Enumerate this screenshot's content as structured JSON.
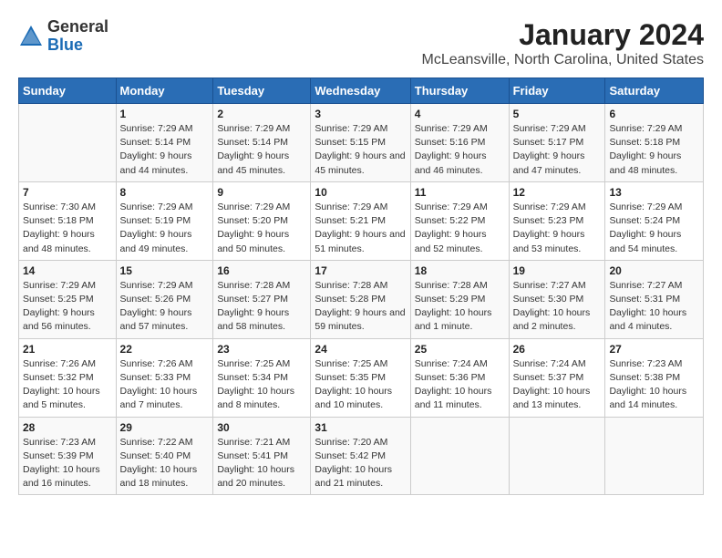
{
  "logo": {
    "general": "General",
    "blue": "Blue"
  },
  "title": "January 2024",
  "subtitle": "McLeansville, North Carolina, United States",
  "days_header": [
    "Sunday",
    "Monday",
    "Tuesday",
    "Wednesday",
    "Thursday",
    "Friday",
    "Saturday"
  ],
  "weeks": [
    [
      {
        "day": "",
        "sunrise": "",
        "sunset": "",
        "daylight": ""
      },
      {
        "day": "1",
        "sunrise": "Sunrise: 7:29 AM",
        "sunset": "Sunset: 5:14 PM",
        "daylight": "Daylight: 9 hours and 44 minutes."
      },
      {
        "day": "2",
        "sunrise": "Sunrise: 7:29 AM",
        "sunset": "Sunset: 5:14 PM",
        "daylight": "Daylight: 9 hours and 45 minutes."
      },
      {
        "day": "3",
        "sunrise": "Sunrise: 7:29 AM",
        "sunset": "Sunset: 5:15 PM",
        "daylight": "Daylight: 9 hours and 45 minutes."
      },
      {
        "day": "4",
        "sunrise": "Sunrise: 7:29 AM",
        "sunset": "Sunset: 5:16 PM",
        "daylight": "Daylight: 9 hours and 46 minutes."
      },
      {
        "day": "5",
        "sunrise": "Sunrise: 7:29 AM",
        "sunset": "Sunset: 5:17 PM",
        "daylight": "Daylight: 9 hours and 47 minutes."
      },
      {
        "day": "6",
        "sunrise": "Sunrise: 7:29 AM",
        "sunset": "Sunset: 5:18 PM",
        "daylight": "Daylight: 9 hours and 48 minutes."
      }
    ],
    [
      {
        "day": "7",
        "sunrise": "Sunrise: 7:30 AM",
        "sunset": "Sunset: 5:18 PM",
        "daylight": "Daylight: 9 hours and 48 minutes."
      },
      {
        "day": "8",
        "sunrise": "Sunrise: 7:29 AM",
        "sunset": "Sunset: 5:19 PM",
        "daylight": "Daylight: 9 hours and 49 minutes."
      },
      {
        "day": "9",
        "sunrise": "Sunrise: 7:29 AM",
        "sunset": "Sunset: 5:20 PM",
        "daylight": "Daylight: 9 hours and 50 minutes."
      },
      {
        "day": "10",
        "sunrise": "Sunrise: 7:29 AM",
        "sunset": "Sunset: 5:21 PM",
        "daylight": "Daylight: 9 hours and 51 minutes."
      },
      {
        "day": "11",
        "sunrise": "Sunrise: 7:29 AM",
        "sunset": "Sunset: 5:22 PM",
        "daylight": "Daylight: 9 hours and 52 minutes."
      },
      {
        "day": "12",
        "sunrise": "Sunrise: 7:29 AM",
        "sunset": "Sunset: 5:23 PM",
        "daylight": "Daylight: 9 hours and 53 minutes."
      },
      {
        "day": "13",
        "sunrise": "Sunrise: 7:29 AM",
        "sunset": "Sunset: 5:24 PM",
        "daylight": "Daylight: 9 hours and 54 minutes."
      }
    ],
    [
      {
        "day": "14",
        "sunrise": "Sunrise: 7:29 AM",
        "sunset": "Sunset: 5:25 PM",
        "daylight": "Daylight: 9 hours and 56 minutes."
      },
      {
        "day": "15",
        "sunrise": "Sunrise: 7:29 AM",
        "sunset": "Sunset: 5:26 PM",
        "daylight": "Daylight: 9 hours and 57 minutes."
      },
      {
        "day": "16",
        "sunrise": "Sunrise: 7:28 AM",
        "sunset": "Sunset: 5:27 PM",
        "daylight": "Daylight: 9 hours and 58 minutes."
      },
      {
        "day": "17",
        "sunrise": "Sunrise: 7:28 AM",
        "sunset": "Sunset: 5:28 PM",
        "daylight": "Daylight: 9 hours and 59 minutes."
      },
      {
        "day": "18",
        "sunrise": "Sunrise: 7:28 AM",
        "sunset": "Sunset: 5:29 PM",
        "daylight": "Daylight: 10 hours and 1 minute."
      },
      {
        "day": "19",
        "sunrise": "Sunrise: 7:27 AM",
        "sunset": "Sunset: 5:30 PM",
        "daylight": "Daylight: 10 hours and 2 minutes."
      },
      {
        "day": "20",
        "sunrise": "Sunrise: 7:27 AM",
        "sunset": "Sunset: 5:31 PM",
        "daylight": "Daylight: 10 hours and 4 minutes."
      }
    ],
    [
      {
        "day": "21",
        "sunrise": "Sunrise: 7:26 AM",
        "sunset": "Sunset: 5:32 PM",
        "daylight": "Daylight: 10 hours and 5 minutes."
      },
      {
        "day": "22",
        "sunrise": "Sunrise: 7:26 AM",
        "sunset": "Sunset: 5:33 PM",
        "daylight": "Daylight: 10 hours and 7 minutes."
      },
      {
        "day": "23",
        "sunrise": "Sunrise: 7:25 AM",
        "sunset": "Sunset: 5:34 PM",
        "daylight": "Daylight: 10 hours and 8 minutes."
      },
      {
        "day": "24",
        "sunrise": "Sunrise: 7:25 AM",
        "sunset": "Sunset: 5:35 PM",
        "daylight": "Daylight: 10 hours and 10 minutes."
      },
      {
        "day": "25",
        "sunrise": "Sunrise: 7:24 AM",
        "sunset": "Sunset: 5:36 PM",
        "daylight": "Daylight: 10 hours and 11 minutes."
      },
      {
        "day": "26",
        "sunrise": "Sunrise: 7:24 AM",
        "sunset": "Sunset: 5:37 PM",
        "daylight": "Daylight: 10 hours and 13 minutes."
      },
      {
        "day": "27",
        "sunrise": "Sunrise: 7:23 AM",
        "sunset": "Sunset: 5:38 PM",
        "daylight": "Daylight: 10 hours and 14 minutes."
      }
    ],
    [
      {
        "day": "28",
        "sunrise": "Sunrise: 7:23 AM",
        "sunset": "Sunset: 5:39 PM",
        "daylight": "Daylight: 10 hours and 16 minutes."
      },
      {
        "day": "29",
        "sunrise": "Sunrise: 7:22 AM",
        "sunset": "Sunset: 5:40 PM",
        "daylight": "Daylight: 10 hours and 18 minutes."
      },
      {
        "day": "30",
        "sunrise": "Sunrise: 7:21 AM",
        "sunset": "Sunset: 5:41 PM",
        "daylight": "Daylight: 10 hours and 20 minutes."
      },
      {
        "day": "31",
        "sunrise": "Sunrise: 7:20 AM",
        "sunset": "Sunset: 5:42 PM",
        "daylight": "Daylight: 10 hours and 21 minutes."
      },
      {
        "day": "",
        "sunrise": "",
        "sunset": "",
        "daylight": ""
      },
      {
        "day": "",
        "sunrise": "",
        "sunset": "",
        "daylight": ""
      },
      {
        "day": "",
        "sunrise": "",
        "sunset": "",
        "daylight": ""
      }
    ]
  ]
}
